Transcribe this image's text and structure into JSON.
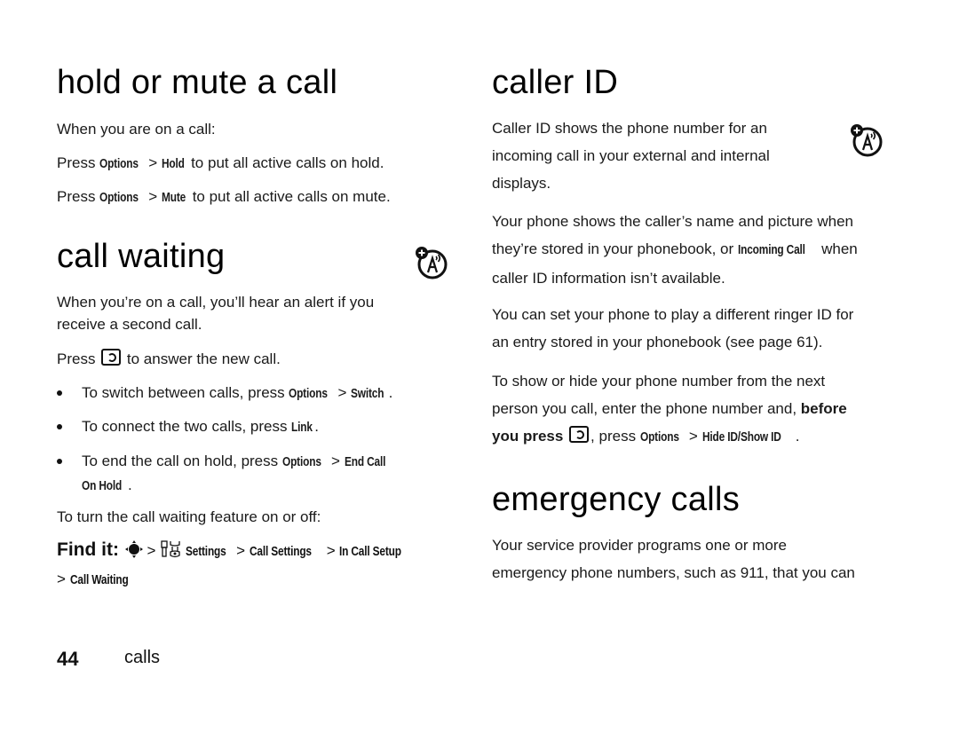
{
  "left": {
    "hold_section": {
      "heading": "hold or mute a call",
      "intro": "When you are on a call:",
      "hold_line": {
        "prefix": "Press ",
        "k1": "Options",
        "sep": " > ",
        "k2": "Hold",
        "suffix": " to put all active calls on hold."
      },
      "mute_line": {
        "prefix": "Press ",
        "k1": "Options",
        "sep": " > ",
        "k2": "Mute",
        "suffix": " to put all active calls on mute."
      }
    },
    "waiting_section": {
      "heading": "call waiting",
      "badge_icon": "network-feature-icon",
      "intro_line1": "When you’re on a call, you’ll hear an alert if you",
      "intro_line2": "receive a second call.",
      "answer": {
        "prefix": "Press ",
        "key_icon": "send-key-icon",
        "suffix": " to answer the new call."
      },
      "bullets": [
        {
          "text": "To switch between calls, press ",
          "k1": "Options",
          "sep": " > ",
          "k2": "Switch",
          "end": "."
        },
        {
          "text": "To connect the two calls, press ",
          "k1": "Link",
          "end": "."
        },
        {
          "text": "To end the call on hold, press ",
          "k1": "Options",
          "sep": " > ",
          "k2": "End Call",
          "line2": "On Hold",
          "end": "."
        }
      ],
      "toggle_intro": "To turn the call waiting feature on or off:",
      "find_it": {
        "label": "Find it:",
        "nav_icon": "nav-key-icon",
        "settings_icon": "settings-tools-icon",
        "path": [
          "Settings",
          "Call Settings",
          "In Call Setup",
          "Call Waiting"
        ],
        "sep": " > "
      }
    }
  },
  "right": {
    "caller_id_section": {
      "heading": "caller ID",
      "badge_icon": "network-feature-icon",
      "p1_line1": "Caller ID shows the phone number for an",
      "p1_line2": "incoming call in your external and internal",
      "p1_line3": "displays.",
      "p2_line1": "Your phone shows the caller’s name and picture when",
      "p2_line2_a": "they’re stored in your phonebook, or ",
      "p2_line2_k": "Incoming Call",
      "p2_line2_b": " when",
      "p2_line3": "caller ID information isn’t available.",
      "p3_line1": "You can set your phone to play a different ringer ID for",
      "p3_line2": "an entry stored in your phonebook (see page 61).",
      "p4_line1": "To show or hide your phone number from the next",
      "p4_line2_a": "person you call, enter the phone number and, ",
      "p4_line2_b": "before",
      "p4_line3_b": "you press ",
      "p4_line3_a": ", press ",
      "p4_k1": "Options",
      "p4_sep": " > ",
      "p4_k2": "Hide ID/Show ID",
      "p4_end": "."
    },
    "emergency_section": {
      "heading": "emergency calls",
      "line1": "Your service provider programs one or more",
      "line2": "emergency phone numbers, such as 911, that you can"
    }
  },
  "footer": {
    "page_number": "44",
    "section": "calls"
  }
}
